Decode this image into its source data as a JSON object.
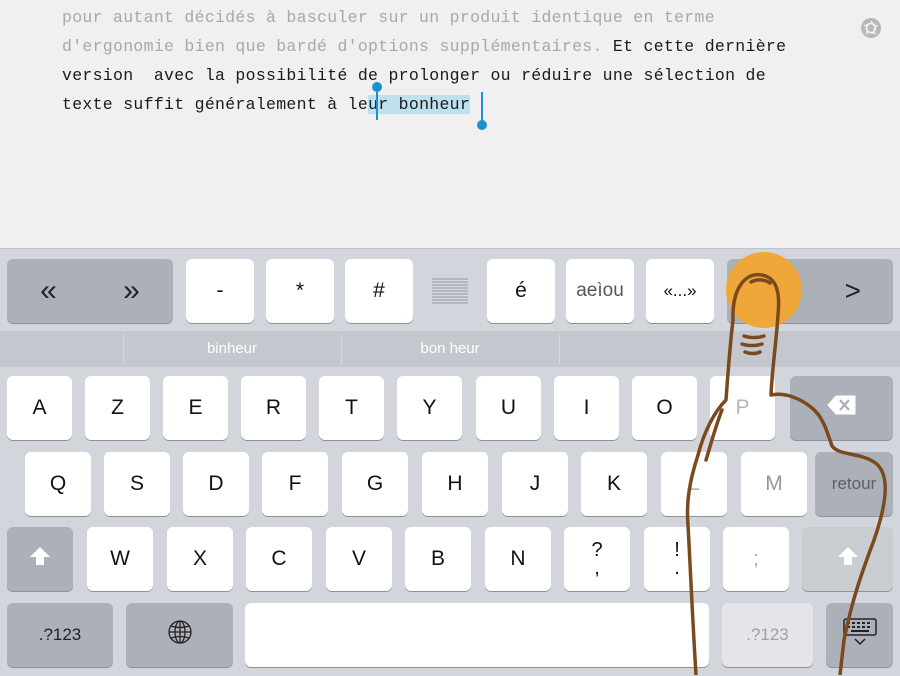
{
  "editor": {
    "line1": "pour autant décidés à basculer sur un produit identique en terme",
    "line2_faded": "d'ergonomie bien que bardé d'options supplémentaires.",
    "line2_dark": " Et cette dernière",
    "line3": "version  avec la possibilité de prolonger ou réduire une sélection de",
    "line4_before": "texte suffit généralement à le",
    "line4_selected": "ur bonheur"
  },
  "toolbar": {
    "prev_label": "«",
    "next_label": "»",
    "dash": "-",
    "asterisk": "*",
    "hash": "#",
    "e_acute": "é",
    "accents": "aeìou",
    "quotes": "«...»",
    "arrow_right": ">"
  },
  "suggestions": [
    "binheur",
    "bon heur",
    ""
  ],
  "rows": {
    "row1": [
      "A",
      "Z",
      "E",
      "R",
      "T",
      "Y",
      "U",
      "I",
      "O",
      "P"
    ],
    "row2": [
      "Q",
      "S",
      "D",
      "F",
      "G",
      "H",
      "J",
      "K",
      "L",
      "M"
    ],
    "row3": [
      "W",
      "X",
      "C",
      "V",
      "B",
      "N"
    ],
    "row3_punct": [
      [
        "?",
        ","
      ],
      [
        "!",
        "."
      ],
      [
        "",
        ";"
      ]
    ]
  },
  "keys": {
    "return_label": "retour",
    "numbers_left": ".?123",
    "numbers_right": ".?123"
  },
  "colors": {
    "selection": "#bfe0ef",
    "handle": "#1e8fd0",
    "touch_circle": "#f0a73a",
    "hand_outline": "#7a4a1e"
  }
}
